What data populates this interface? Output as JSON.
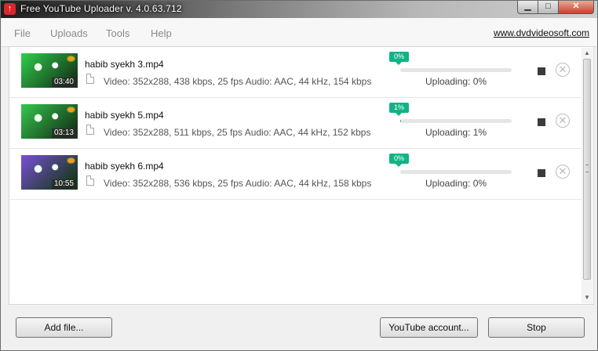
{
  "window": {
    "title": "Free YouTube Uploader v. 4.0.63.712",
    "app_icon": "up-arrow-icon",
    "brand_color": "#d7282d"
  },
  "window_controls": {
    "minimize": "▁",
    "maximize": "□",
    "close": "✕"
  },
  "menu": {
    "items": [
      "File",
      "Uploads",
      "Tools",
      "Help"
    ],
    "site_link": "www.dvdvideosoft.com"
  },
  "uploads": [
    {
      "filename": "habib syekh 3.mp4",
      "duration": "03:40",
      "info": "Video: 352x288, 438 kbps, 25 fps Audio: AAC, 44 kHz, 154 kbps",
      "percent_label": "0%",
      "progress": 0,
      "status": "Uploading: 0%",
      "thumb_color": "#2fd04a"
    },
    {
      "filename": "habib syekh 5.mp4",
      "duration": "03:13",
      "info": "Video: 352x288, 511 kbps, 25 fps Audio: AAC, 44 kHz, 152 kbps",
      "percent_label": "1%",
      "progress": 1,
      "status": "Uploading: 1%",
      "thumb_color": "#34c84e"
    },
    {
      "filename": "habib syekh 6.mp4",
      "duration": "10:55",
      "info": "Video: 352x288, 536 kbps, 25 fps Audio: AAC, 44 kHz, 158 kbps",
      "percent_label": "0%",
      "progress": 0,
      "status": "Uploading: 0%",
      "thumb_color": "#7a4fd8"
    }
  ],
  "buttons": {
    "add_file": "Add file...",
    "youtube_account": "YouTube account...",
    "stop": "Stop"
  },
  "colors": {
    "accent": "#11b386"
  }
}
